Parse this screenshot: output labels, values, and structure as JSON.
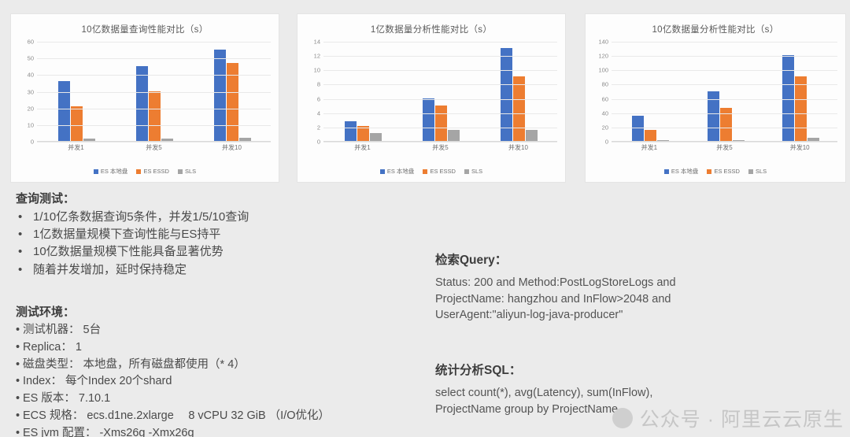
{
  "charts": [
    {
      "id": "chart-1",
      "title": "10亿数据量查询性能对比（s）",
      "chart_data": {
        "type": "bar",
        "title": "10亿数据量查询性能对比（s）",
        "xlabel": "",
        "ylabel": "",
        "ylim": [
          0,
          60
        ],
        "yticks": [
          0,
          10,
          20,
          30,
          40,
          50,
          60
        ],
        "grid": true,
        "legend_position": "bottom",
        "categories": [
          "并发1",
          "并发5",
          "并发10"
        ],
        "series": [
          {
            "name": "ES 本地盘",
            "color": "#4472c4",
            "values": [
              36,
              45,
              55
            ]
          },
          {
            "name": "ES ESSD",
            "color": "#ed7d31",
            "values": [
              21,
              30,
              47
            ]
          },
          {
            "name": "SLS",
            "color": "#a5a5a5",
            "values": [
              1.5,
              1.5,
              2
            ]
          }
        ]
      }
    },
    {
      "id": "chart-2",
      "title": "1亿数据量分析性能对比（s）",
      "chart_data": {
        "type": "bar",
        "title": "1亿数据量分析性能对比（s）",
        "xlabel": "",
        "ylabel": "",
        "ylim": [
          0,
          14
        ],
        "yticks": [
          0,
          2,
          4,
          6,
          8,
          10,
          12,
          14
        ],
        "grid": true,
        "legend_position": "bottom",
        "categories": [
          "并发1",
          "并发5",
          "并发10"
        ],
        "series": [
          {
            "name": "ES 本地盘",
            "color": "#4472c4",
            "values": [
              2.75,
              6,
              13
            ]
          },
          {
            "name": "ES ESSD",
            "color": "#ed7d31",
            "values": [
              2.1,
              5,
              9
            ]
          },
          {
            "name": "SLS",
            "color": "#a5a5a5",
            "values": [
              1.1,
              1.5,
              1.6
            ]
          }
        ]
      }
    },
    {
      "id": "chart-3",
      "title": "10亿数据量分析性能对比（s）",
      "chart_data": {
        "type": "bar",
        "title": "10亿数据量分析性能对比（s）",
        "xlabel": "",
        "ylabel": "",
        "ylim": [
          0,
          140
        ],
        "yticks": [
          0,
          20,
          40,
          60,
          80,
          100,
          120,
          140
        ],
        "grid": true,
        "legend_position": "bottom",
        "categories": [
          "并发1",
          "并发5",
          "并发10"
        ],
        "series": [
          {
            "name": "ES 本地盘",
            "color": "#4472c4",
            "values": [
              35,
              70,
              120
            ]
          },
          {
            "name": "ES ESSD",
            "color": "#ed7d31",
            "values": [
              16,
              46,
              90
            ]
          },
          {
            "name": "SLS",
            "color": "#a5a5a5",
            "values": [
              1,
              1,
              4
            ]
          }
        ]
      }
    }
  ],
  "query_test": {
    "heading": "查询测试：",
    "items": [
      "1/10亿条数据查询5条件，并发1/5/10查询",
      "1亿数据量规模下查询性能与ES持平",
      "10亿数据量规模下性能具备显著优势",
      "随着并发增加，延时保持稳定"
    ]
  },
  "test_env": {
    "heading": "测试环境：",
    "items": [
      "测试机器： 5台",
      "Replica： 1",
      "磁盘类型： 本地盘，所有磁盘都使用（* 4）",
      "Index： 每个Index 20个shard",
      "ES 版本： 7.10.1",
      "ECS 规格： ecs.d1ne.2xlarge　 8 vCPU 32 GiB （I/O优化）",
      "ES jvm 配置： -Xms26g -Xmx26g"
    ]
  },
  "search_query": {
    "heading": "检索Query：",
    "body": "Status: 200 and Method:PostLogStoreLogs and ProjectName: hangzhou and InFlow>2048 and UserAgent:\"aliyun-log-java-producer\""
  },
  "analysis_sql": {
    "heading": "统计分析SQL：",
    "body": "select count(*), avg(Latency), sum(InFlow), ProjectName group by ProjectName"
  },
  "watermark": {
    "text": "公众号 · 阿里云云原生"
  },
  "colors": {
    "series_blue": "#4472c4",
    "series_orange": "#ed7d31",
    "series_gray": "#a5a5a5",
    "page_background": "#ebebeb",
    "card_background": "#fdfdfd"
  }
}
